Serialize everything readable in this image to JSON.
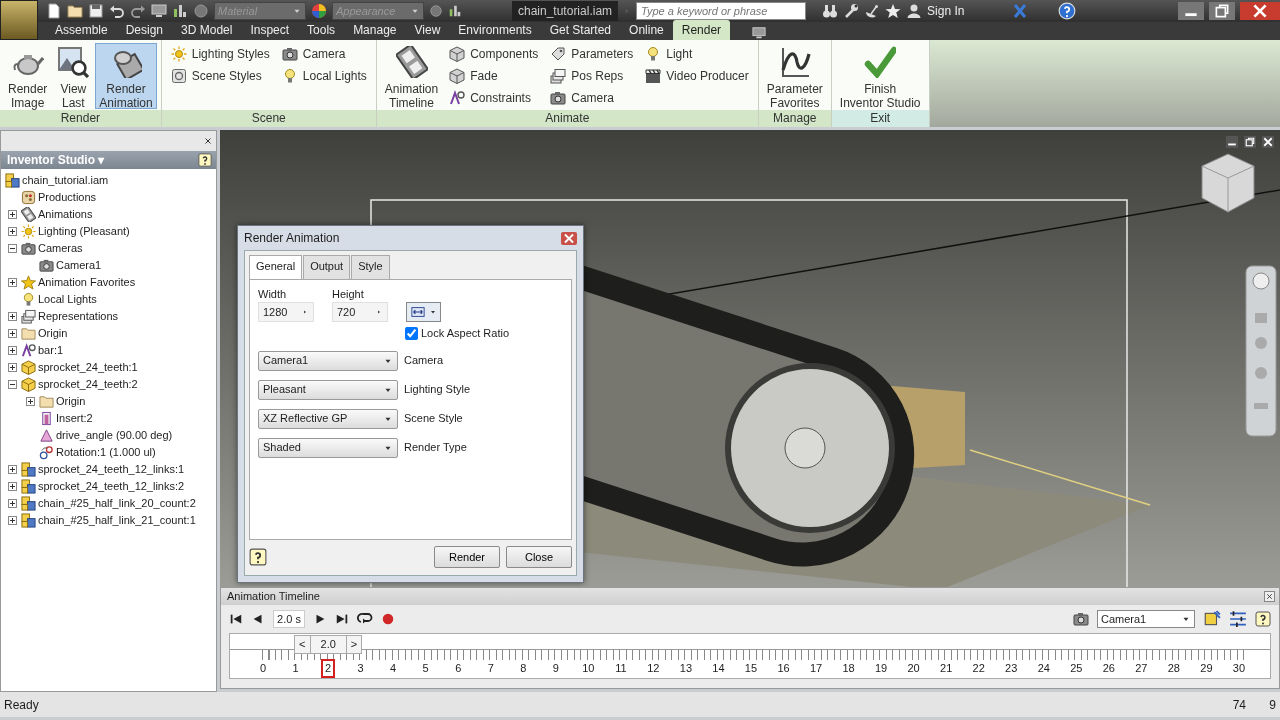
{
  "title_bar": {
    "material": {
      "value": "Material",
      "disabled": true
    },
    "appearance": {
      "value": "Appearance",
      "disabled": true
    },
    "document": "chain_tutorial.iam",
    "search": {
      "placeholder": "Type a keyword or phrase"
    },
    "sign_in": "Sign In"
  },
  "menu_tabs": [
    {
      "label": "Assemble",
      "selected": false
    },
    {
      "label": "Design",
      "selected": false
    },
    {
      "label": "3D Model",
      "selected": false
    },
    {
      "label": "Inspect",
      "selected": false
    },
    {
      "label": "Tools",
      "selected": false
    },
    {
      "label": "Manage",
      "selected": false
    },
    {
      "label": "View",
      "selected": false
    },
    {
      "label": "Environments",
      "selected": false
    },
    {
      "label": "Get Started",
      "selected": false
    },
    {
      "label": "Online",
      "selected": false
    },
    {
      "label": "Render",
      "selected": true
    }
  ],
  "ribbon": {
    "panels": [
      {
        "title": "Render",
        "items": [
          {
            "kind": "large",
            "label": "Render\nImage",
            "selected": false
          },
          {
            "kind": "large",
            "label": "View\nLast",
            "selected": false
          },
          {
            "kind": "large",
            "label": "Render\nAnimation",
            "selected": true
          }
        ]
      },
      {
        "title": "Scene",
        "items": [
          {
            "kind": "column",
            "items": [
              {
                "label": "Lighting Styles",
                "selected": false
              },
              {
                "label": "Scene Styles",
                "selected": false
              }
            ]
          },
          {
            "kind": "column",
            "items": [
              {
                "label": "Camera",
                "selected": false
              },
              {
                "label": "Local Lights",
                "selected": false
              }
            ]
          }
        ]
      },
      {
        "title": "Animate",
        "items": [
          {
            "kind": "large",
            "label": "Animation\nTimeline",
            "selected": false
          },
          {
            "kind": "column",
            "items": [
              {
                "label": "Components",
                "selected": false
              },
              {
                "label": "Fade",
                "selected": false
              },
              {
                "label": "Constraints",
                "selected": false
              }
            ]
          },
          {
            "kind": "column",
            "items": [
              {
                "label": "Parameters",
                "selected": false
              },
              {
                "label": "Pos Reps",
                "selected": false
              },
              {
                "label": "Camera",
                "selected": false
              }
            ]
          },
          {
            "kind": "column",
            "items": [
              {
                "label": "Light",
                "selected": false
              },
              {
                "label": "Video Producer",
                "selected": false
              }
            ]
          }
        ]
      },
      {
        "title": "Manage",
        "items": [
          {
            "kind": "large",
            "label": "Parameter\nFavorites",
            "selected": false
          }
        ]
      },
      {
        "title": "Exit",
        "items": [
          {
            "kind": "large",
            "label": "Finish\nInventor Studio",
            "selected": false
          }
        ]
      }
    ]
  },
  "browser": {
    "title": "Inventor Studio ▾",
    "tree": {
      "label": "chain_tutorial.iam",
      "children": [
        {
          "label": "Productions"
        },
        {
          "label": "Animations",
          "expanded": false
        },
        {
          "label": "Lighting (Pleasant)",
          "expanded": false
        },
        {
          "label": "Cameras",
          "expanded": true,
          "children": [
            {
              "label": "Camera1"
            }
          ]
        },
        {
          "label": "Animation Favorites",
          "expanded": false
        },
        {
          "label": "Local Lights"
        },
        {
          "label": "Representations",
          "expanded": false
        },
        {
          "label": "Origin",
          "expanded": false
        },
        {
          "label": "bar:1",
          "expanded": false
        },
        {
          "label": "sprocket_24_teeth:1",
          "expanded": false
        },
        {
          "label": "sprocket_24_teeth:2",
          "expanded": true,
          "children": [
            {
              "label": "Origin",
              "expanded": false
            },
            {
              "label": "Insert:2"
            },
            {
              "label": "drive_angle (90.00 deg)"
            },
            {
              "label": "Rotation:1 (1.000 ul)"
            }
          ]
        },
        {
          "label": "sprocket_24_teeth_12_links:1",
          "expanded": false
        },
        {
          "label": "sprocket_24_teeth_12_links:2",
          "expanded": false
        },
        {
          "label": "chain_#25_half_link_20_count:2",
          "expanded": false
        },
        {
          "label": "chain_#25_half_link_21_count:1",
          "expanded": false
        }
      ]
    }
  },
  "dialog": {
    "title": "Render Animation",
    "tabs": [
      {
        "label": "General",
        "selected": true
      },
      {
        "label": "Output",
        "selected": false
      },
      {
        "label": "Style",
        "selected": false
      }
    ],
    "width": {
      "label": "Width",
      "value": "1280"
    },
    "height": {
      "label": "Height",
      "value": "720"
    },
    "lock_aspect": {
      "label": "Lock Aspect Ratio",
      "checked": true
    },
    "dropdowns": [
      {
        "value": "Camera1",
        "label": "Camera"
      },
      {
        "value": "Pleasant",
        "label": "Lighting Style"
      },
      {
        "value": "XZ Reflective GP",
        "label": "Scene Style"
      },
      {
        "value": "Shaded",
        "label": "Render Type"
      }
    ],
    "buttons": [
      "Render",
      "Close"
    ]
  },
  "timeline": {
    "title": "Animation Timeline",
    "time": "2.0 s",
    "camera": "Camera1",
    "scrubber": {
      "prev": "<",
      "value": "2.0",
      "next": ">",
      "level": 0.0667
    },
    "ticks": [
      "0",
      "1",
      "2",
      "3",
      "4",
      "5",
      "6",
      "7",
      "8",
      "9",
      "10",
      "11",
      "12",
      "13",
      "14",
      "15",
      "16",
      "17",
      "18",
      "19",
      "20",
      "21",
      "22",
      "23",
      "24",
      "25",
      "26",
      "27",
      "28",
      "29",
      "30"
    ]
  },
  "status_bar": {
    "text": "Ready",
    "values": [
      "74",
      "9"
    ]
  }
}
